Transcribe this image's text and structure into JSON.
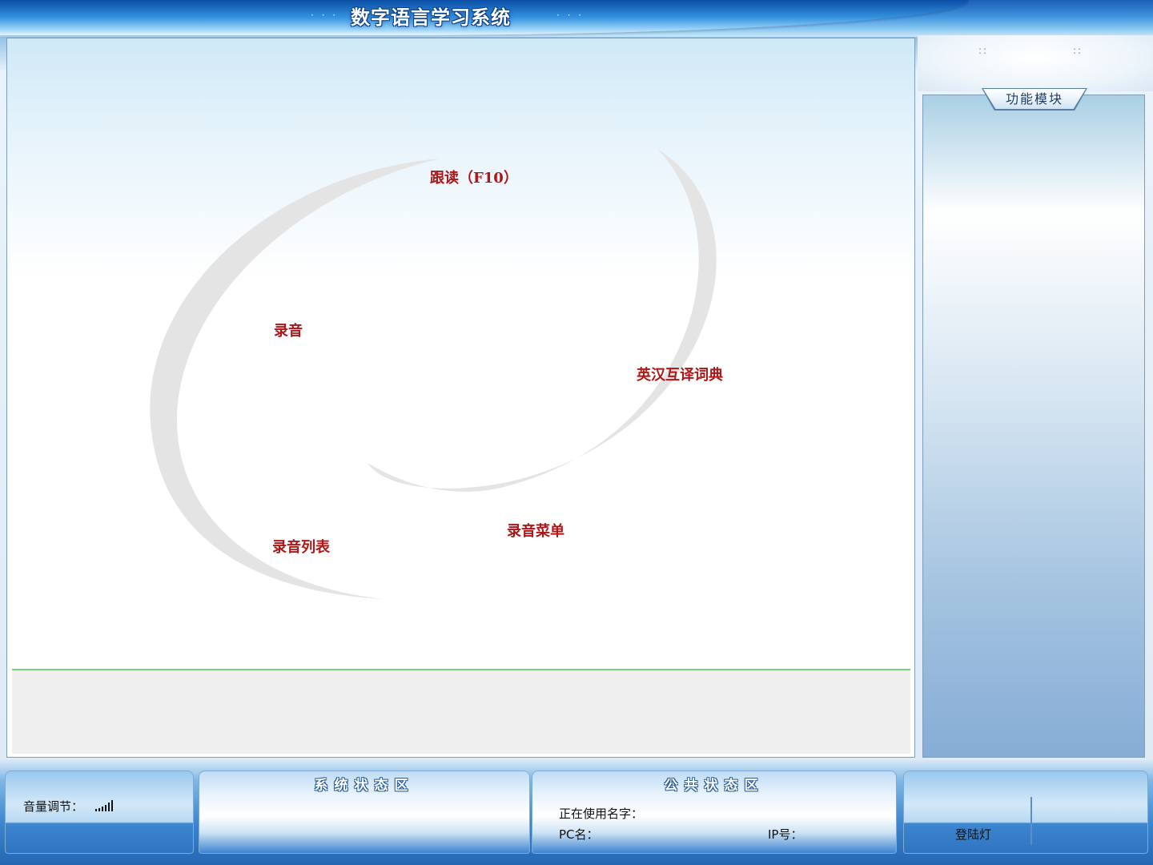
{
  "titlebar": {
    "title": "数字语言学习系统",
    "left_dots": "· · ·",
    "right_dots": "· · ·"
  },
  "main": {
    "menu": {
      "follow_read": "跟读（F10）",
      "record": "录音",
      "dictionary": "英汉互译词典",
      "record_list": "录音列表",
      "record_menu": "录音菜单"
    }
  },
  "module_panel": {
    "tab_label": "功能模块",
    "dots": "::"
  },
  "status_bar": {
    "volume_label": "音量调节：",
    "volume_icon": "volume-bars-icon",
    "system_header": "系统状态区",
    "public_header": "公共状态区",
    "using_name_label": "正在使用名字：",
    "pc_name_label": "PC名：",
    "ip_label": "IP号：",
    "login_light_label": "登陆灯"
  },
  "colors": {
    "menu_text": "#b01616",
    "title_blue": "#1c5fb5",
    "panel_border": "#7f9db9"
  }
}
